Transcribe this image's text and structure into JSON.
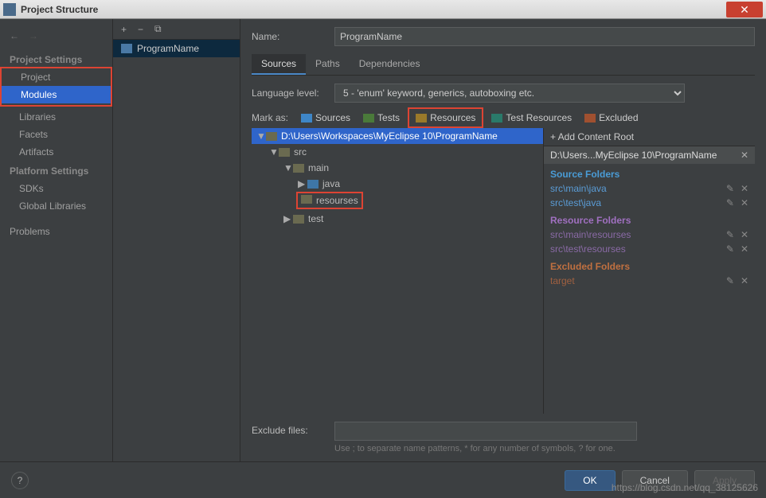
{
  "window": {
    "title": "Project Structure",
    "close": "✕"
  },
  "left": {
    "nav": {
      "back": "←",
      "fwd": "→"
    },
    "project_settings_title": "Project Settings",
    "project_items": [
      "Project",
      "Modules",
      "Libraries",
      "Facets",
      "Artifacts"
    ],
    "platform_settings_title": "Platform Settings",
    "platform_items": [
      "SDKs",
      "Global Libraries"
    ],
    "problems": "Problems"
  },
  "modules": {
    "toolbar": {
      "add": "+",
      "remove": "−",
      "copy": "⧉"
    },
    "module_name": "ProgramName"
  },
  "content": {
    "name_label": "Name:",
    "name_value": "ProgramName",
    "tabs": [
      "Sources",
      "Paths",
      "Dependencies"
    ],
    "lang_label": "Language level:",
    "lang_value": "5 - 'enum' keyword, generics, autoboxing etc.",
    "markas_label": "Mark as:",
    "mark_buttons": [
      {
        "name": "Sources",
        "color": "blue"
      },
      {
        "name": "Tests",
        "color": "green"
      },
      {
        "name": "Resources",
        "color": "yellow"
      },
      {
        "name": "Test Resources",
        "color": "teal"
      },
      {
        "name": "Excluded",
        "color": "orange"
      }
    ],
    "tree": {
      "root": "D:\\Users\\Workspaces\\MyEclipse 10\\ProgramName",
      "nodes": [
        {
          "level": 1,
          "caret": "▼",
          "name": "src"
        },
        {
          "level": 2,
          "caret": "▼",
          "name": "main"
        },
        {
          "level": 3,
          "caret": "▶",
          "name": "java",
          "blue": true
        },
        {
          "level": 3,
          "caret": "",
          "name": "resourses",
          "highlight": true
        },
        {
          "level": 2,
          "caret": "▶",
          "name": "test"
        }
      ]
    },
    "side": {
      "add_root": "+ Add Content Root",
      "root_path": "D:\\Users...MyEclipse 10\\ProgramName",
      "groups": [
        {
          "title": "Source Folders",
          "color": "blue",
          "items": [
            "src\\main\\java",
            "src\\test\\java"
          ]
        },
        {
          "title": "Resource Folders",
          "color": "purple",
          "items": [
            "src\\main\\resourses",
            "src\\test\\resourses"
          ]
        },
        {
          "title": "Excluded Folders",
          "color": "orange",
          "items": [
            "target"
          ]
        }
      ]
    },
    "exclude_label": "Exclude files:",
    "exclude_hint": "Use ; to separate name patterns, * for any number of symbols, ? for one."
  },
  "footer": {
    "help": "?",
    "ok": "OK",
    "cancel": "Cancel",
    "apply": "Apply"
  },
  "watermark": "https://blog.csdn.net/qq_38125626"
}
